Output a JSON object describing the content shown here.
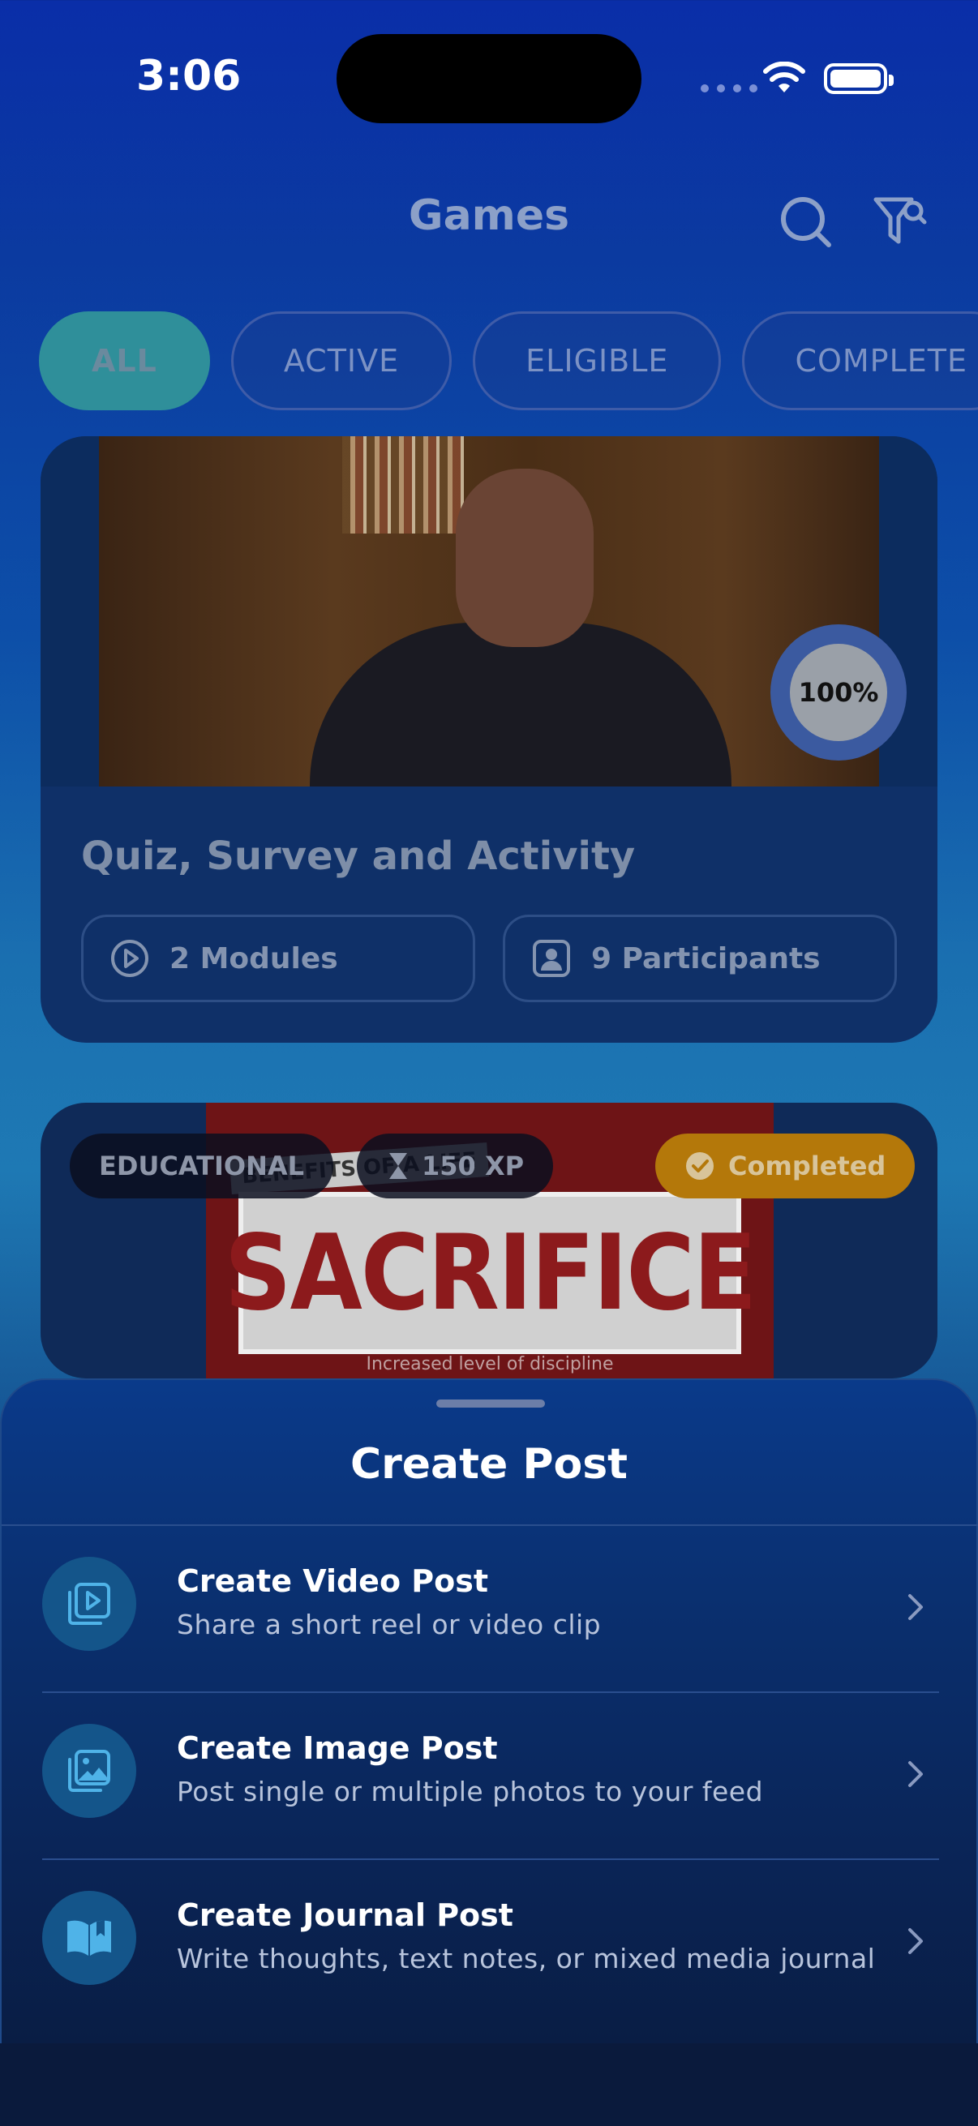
{
  "status": {
    "time": "3:06"
  },
  "header": {
    "title": "Games"
  },
  "filters": [
    "ALL",
    "ACTIVE",
    "ELIGIBLE",
    "COMPLETE"
  ],
  "card1": {
    "title": "Quiz, Survey and Activity",
    "progress": "100%",
    "modules": "2 Modules",
    "participants": "9 Participants"
  },
  "card2": {
    "category": "EDUCATIONAL",
    "xp": "150 XP",
    "status": "Completed",
    "thumb_banner": "BENEFITS OF A LIFE",
    "thumb_word": "SACRIFICE",
    "thumb_caption": "Increased level of discipline"
  },
  "sheet": {
    "title": "Create Post",
    "options": [
      {
        "title": "Create Video Post",
        "subtitle": "Share a short reel or video clip",
        "icon": "video-post-icon"
      },
      {
        "title": "Create Image Post",
        "subtitle": "Post single or multiple photos to your feed",
        "icon": "image-post-icon"
      },
      {
        "title": "Create Journal Post",
        "subtitle": "Write thoughts, text notes, or mixed media journal",
        "icon": "journal-post-icon"
      }
    ]
  },
  "colors": {
    "accent_teal": "#2f8f9a",
    "completed_orange": "#b4780a",
    "icon_blue": "#4fb3e8"
  }
}
